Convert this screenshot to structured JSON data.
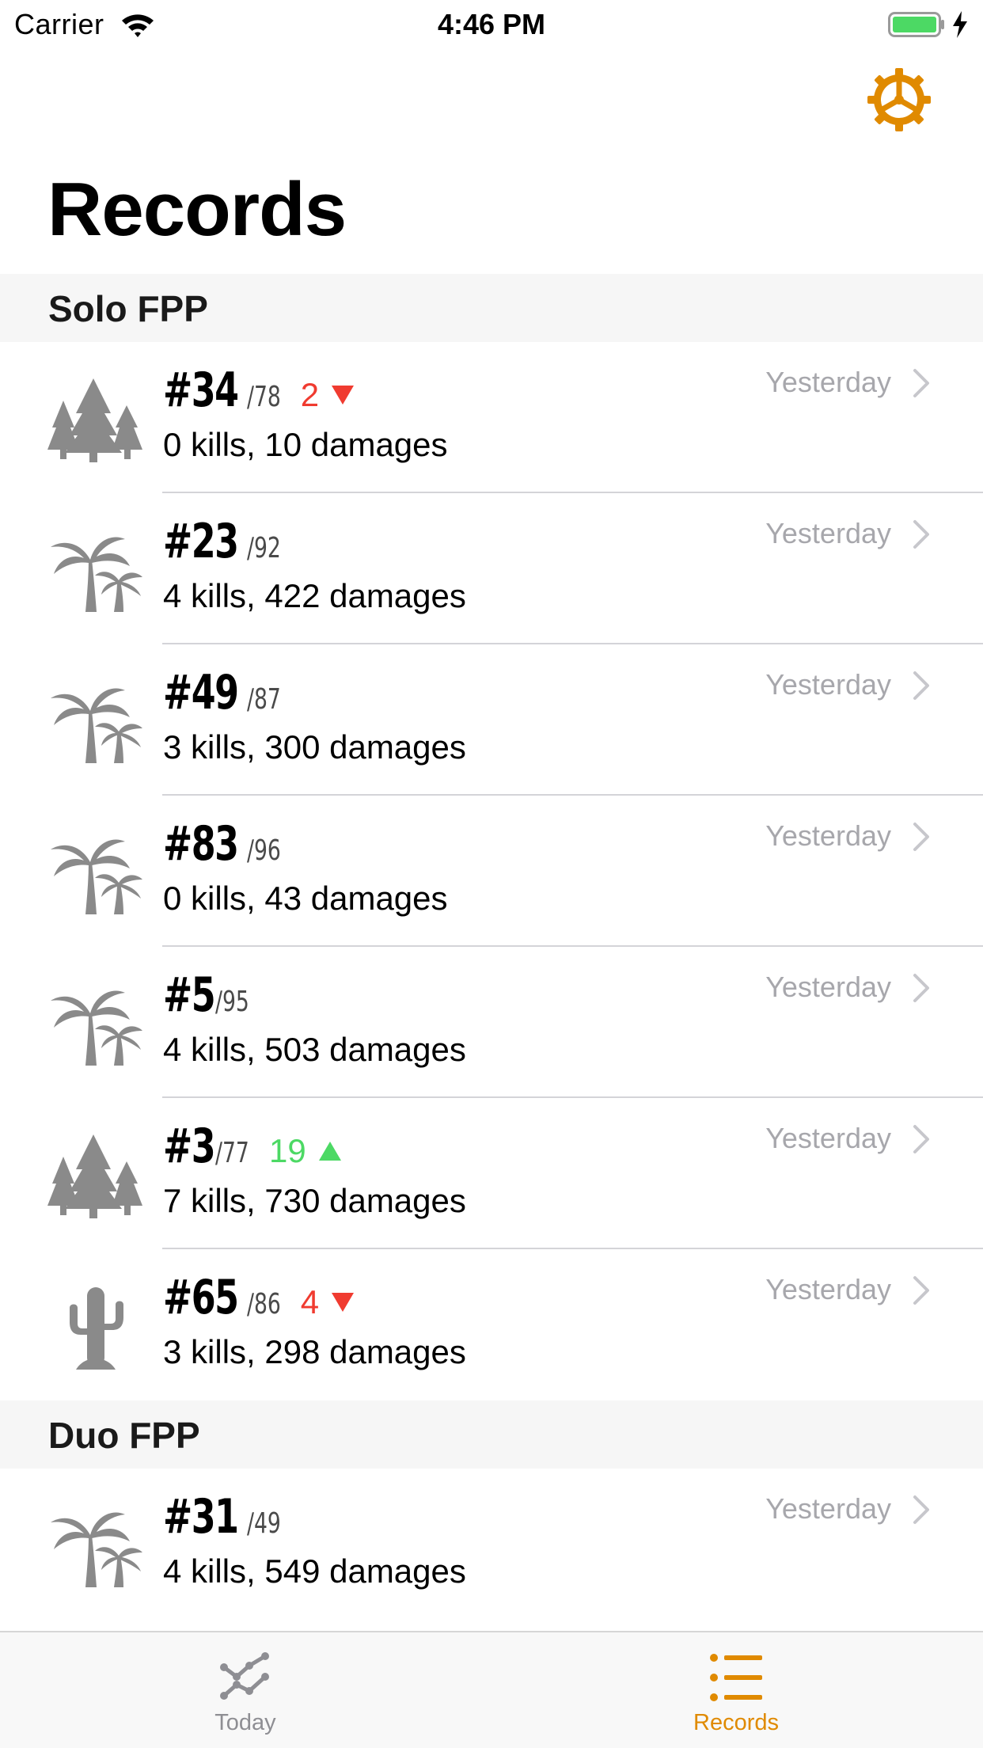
{
  "status_bar": {
    "carrier": "Carrier",
    "time": "4:46 PM"
  },
  "colors": {
    "accent": "#e08a00",
    "rank_down": "#f03b30",
    "rank_up": "#4cd964",
    "icon_gray": "#8a8a8a"
  },
  "header": {
    "title": "Records",
    "settings_icon": "gear-icon"
  },
  "sections": [
    {
      "title": "Solo FPP",
      "rows": [
        {
          "map_icon": "forest-icon",
          "rank": "#34",
          "total": "/78",
          "change": "2",
          "change_dir": "down",
          "stats": "0 kills, 10 damages",
          "date": "Yesterday"
        },
        {
          "map_icon": "palm-icon",
          "rank": "#23",
          "total": "/92",
          "change": "",
          "change_dir": "",
          "stats": "4 kills, 422 damages",
          "date": "Yesterday"
        },
        {
          "map_icon": "palm-icon",
          "rank": "#49",
          "total": "/87",
          "change": "",
          "change_dir": "",
          "stats": "3 kills, 300 damages",
          "date": "Yesterday"
        },
        {
          "map_icon": "palm-icon",
          "rank": "#83",
          "total": "/96",
          "change": "",
          "change_dir": "",
          "stats": "0 kills, 43 damages",
          "date": "Yesterday"
        },
        {
          "map_icon": "palm-icon",
          "rank": "#5",
          "total": "/95",
          "change": "",
          "change_dir": "",
          "stats": "4 kills, 503 damages",
          "date": "Yesterday"
        },
        {
          "map_icon": "forest-icon",
          "rank": "#3",
          "total": "/77",
          "change": "19",
          "change_dir": "up",
          "stats": "7 kills, 730 damages",
          "date": "Yesterday"
        },
        {
          "map_icon": "cactus-icon",
          "rank": "#65",
          "total": "/86",
          "change": "4",
          "change_dir": "down",
          "stats": "3 kills, 298 damages",
          "date": "Yesterday"
        }
      ]
    },
    {
      "title": "Duo FPP",
      "rows": [
        {
          "map_icon": "palm-icon",
          "rank": "#31",
          "total": "/49",
          "change": "",
          "change_dir": "",
          "stats": "4 kills, 549 damages",
          "date": "Yesterday"
        }
      ]
    }
  ],
  "tab_bar": {
    "tabs": [
      {
        "label": "Today",
        "icon": "line-chart-icon",
        "selected": false
      },
      {
        "label": "Records",
        "icon": "list-icon",
        "selected": true
      }
    ]
  }
}
